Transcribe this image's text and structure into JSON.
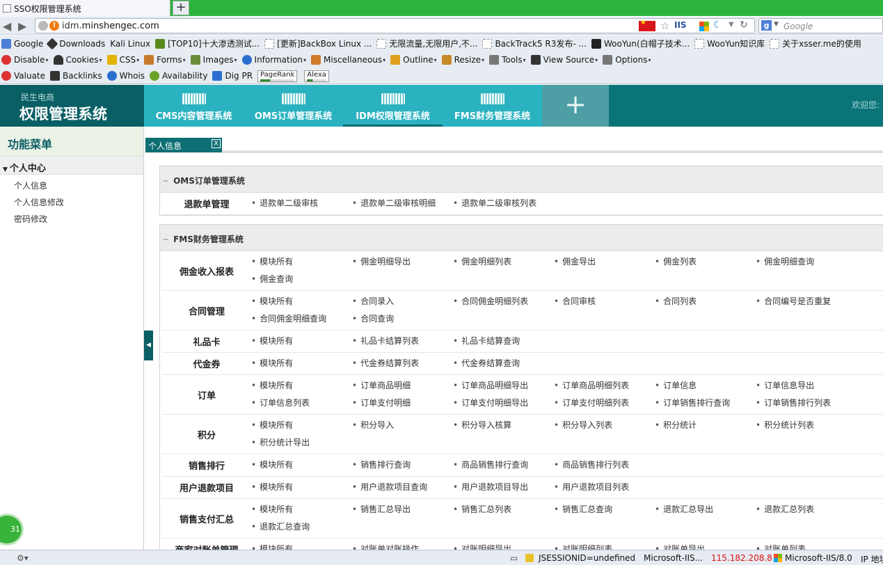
{
  "browser": {
    "tab_title": "SSO权限管理系统",
    "new_tab": "+",
    "url_prefix": "idm.",
    "url_domain": "minshengec.com",
    "iis_badge": "IIS",
    "search_placeholder": "Google",
    "bookmarks": [
      {
        "label": "Google",
        "icon": "google-icon"
      },
      {
        "label": "Downloads",
        "icon": "knife-icon"
      },
      {
        "label": "Kali Linux",
        "icon": ""
      },
      {
        "label": "[TOP10]十大渗透测试...",
        "icon": "f-icon"
      },
      {
        "label": "[更新]BackBox Linux ...",
        "icon": "page-icon"
      },
      {
        "label": "无限流量,无限用户,不...",
        "icon": "page-icon"
      },
      {
        "label": "BackTrack5 R3发布- ...",
        "icon": "page-icon"
      },
      {
        "label": "WooYun(白帽子技术...",
        "icon": "wooyun-icon"
      },
      {
        "label": "WooYun知识库",
        "icon": "page-icon"
      },
      {
        "label": "关于xsser.me的使用",
        "icon": "page-icon"
      }
    ],
    "devtools": [
      {
        "label": "Disable",
        "color": "#d33"
      },
      {
        "label": "Cookies",
        "color": "#333"
      },
      {
        "label": "CSS",
        "color": "#e2b400"
      },
      {
        "label": "Forms",
        "color": "#c77a2c"
      },
      {
        "label": "Images",
        "color": "#6a8d3a"
      },
      {
        "label": "Information",
        "color": "#2a6fd0"
      },
      {
        "label": "Miscellaneous",
        "color": "#d07a2a"
      },
      {
        "label": "Outline",
        "color": "#e0a020"
      },
      {
        "label": "Resize",
        "color": "#c78a2a"
      },
      {
        "label": "Tools",
        "color": "#777"
      },
      {
        "label": "View Source",
        "color": "#333"
      },
      {
        "label": "Options",
        "color": "#777"
      }
    ],
    "seotools": [
      {
        "label": "Valuate",
        "color": "#d33"
      },
      {
        "label": "Backlinks",
        "color": "#333"
      },
      {
        "label": "Whois",
        "color": "#2a6fd0"
      },
      {
        "label": "Availability",
        "color": "#6aa32a"
      },
      {
        "label": "Dig PR",
        "color": "#2a6fd0"
      }
    ],
    "pagerank_label": "PageRank",
    "alexa_label": "Alexa"
  },
  "header": {
    "brand": "民生电商",
    "title": "权限管理系统",
    "systems": [
      {
        "label": "CMS内容管理系统"
      },
      {
        "label": "OMS订单管理系统"
      },
      {
        "label": "IDM权限管理系统"
      },
      {
        "label": "FMS财务管理系统"
      }
    ],
    "add_label": "+",
    "welcome": "欢迎您:"
  },
  "sidebar": {
    "title": "功能菜单",
    "group": "个人中心",
    "items": [
      "个人信息",
      "个人信息修改",
      "密码修改"
    ]
  },
  "tabs": {
    "current": "个人信息",
    "close": "X"
  },
  "panels": [
    {
      "title": "OMS订单管理系统",
      "rows": [
        {
          "label": "退款单管理",
          "links": [
            "退款单二级审核",
            "退款单二级审核明细",
            "退款单二级审核列表"
          ]
        }
      ]
    },
    {
      "title": "FMS财务管理系统",
      "rows": [
        {
          "label": "佣金收入报表",
          "links": [
            "模块所有",
            "佣金明细导出",
            "佣金明细列表",
            "佣金导出",
            "佣金列表",
            "佣金明细查询",
            "佣金查询"
          ]
        },
        {
          "label": "合同管理",
          "links": [
            "模块所有",
            "合同录入",
            "合同佣金明细列表",
            "合同审核",
            "合同列表",
            "合同编号是否重复",
            "合同佣金明细查询",
            "合同查询"
          ]
        },
        {
          "label": "礼品卡",
          "links": [
            "模块所有",
            "礼品卡结算列表",
            "礼品卡结算查询"
          ]
        },
        {
          "label": "代金券",
          "links": [
            "模块所有",
            "代金券结算列表",
            "代金券结算查询"
          ]
        },
        {
          "label": "订单",
          "links": [
            "模块所有",
            "订单商品明细",
            "订单商品明细导出",
            "订单商品明细列表",
            "订单信息",
            "订单信息导出",
            "订单信息列表",
            "订单支付明细",
            "订单支付明细导出",
            "订单支付明细列表",
            "订单销售排行查询",
            "订单销售排行列表"
          ]
        },
        {
          "label": "积分",
          "links": [
            "模块所有",
            "积分导入",
            "积分导入核算",
            "积分导入列表",
            "积分统计",
            "积分统计列表",
            "积分统计导出"
          ]
        },
        {
          "label": "销售排行",
          "links": [
            "模块所有",
            "销售排行查询",
            "商品销售排行查询",
            "商品销售排行列表"
          ]
        },
        {
          "label": "用户退款项目",
          "links": [
            "模块所有",
            "用户退款项目查询",
            "用户退款项目导出",
            "用户退款项目列表"
          ]
        },
        {
          "label": "销售支付汇总",
          "links": [
            "模块所有",
            "销售汇总导出",
            "销售汇总列表",
            "销售汇总查询",
            "退款汇总导出",
            "退款汇总列表",
            "退款汇总查询"
          ]
        },
        {
          "label": "商家对账单管理",
          "links": [
            "模块所有",
            "对账单对账操作",
            "对账明细导出",
            "对账明细列表",
            "对账单导出",
            "对账单列表"
          ]
        }
      ]
    }
  ],
  "statusbar": {
    "session": "JSESSIONID=undefined",
    "server1": "Microsoft-IIS...",
    "ip": "115.182.208.8",
    "server2": "Microsoft-IIS/8.0",
    "ip_label": "IP 地址",
    "bubble": "31"
  },
  "colors": {
    "header_bg": "#0b7479",
    "nav_active": "#2ab2c0",
    "tab_strip": "#2db43d",
    "ip_red": "#d11"
  }
}
